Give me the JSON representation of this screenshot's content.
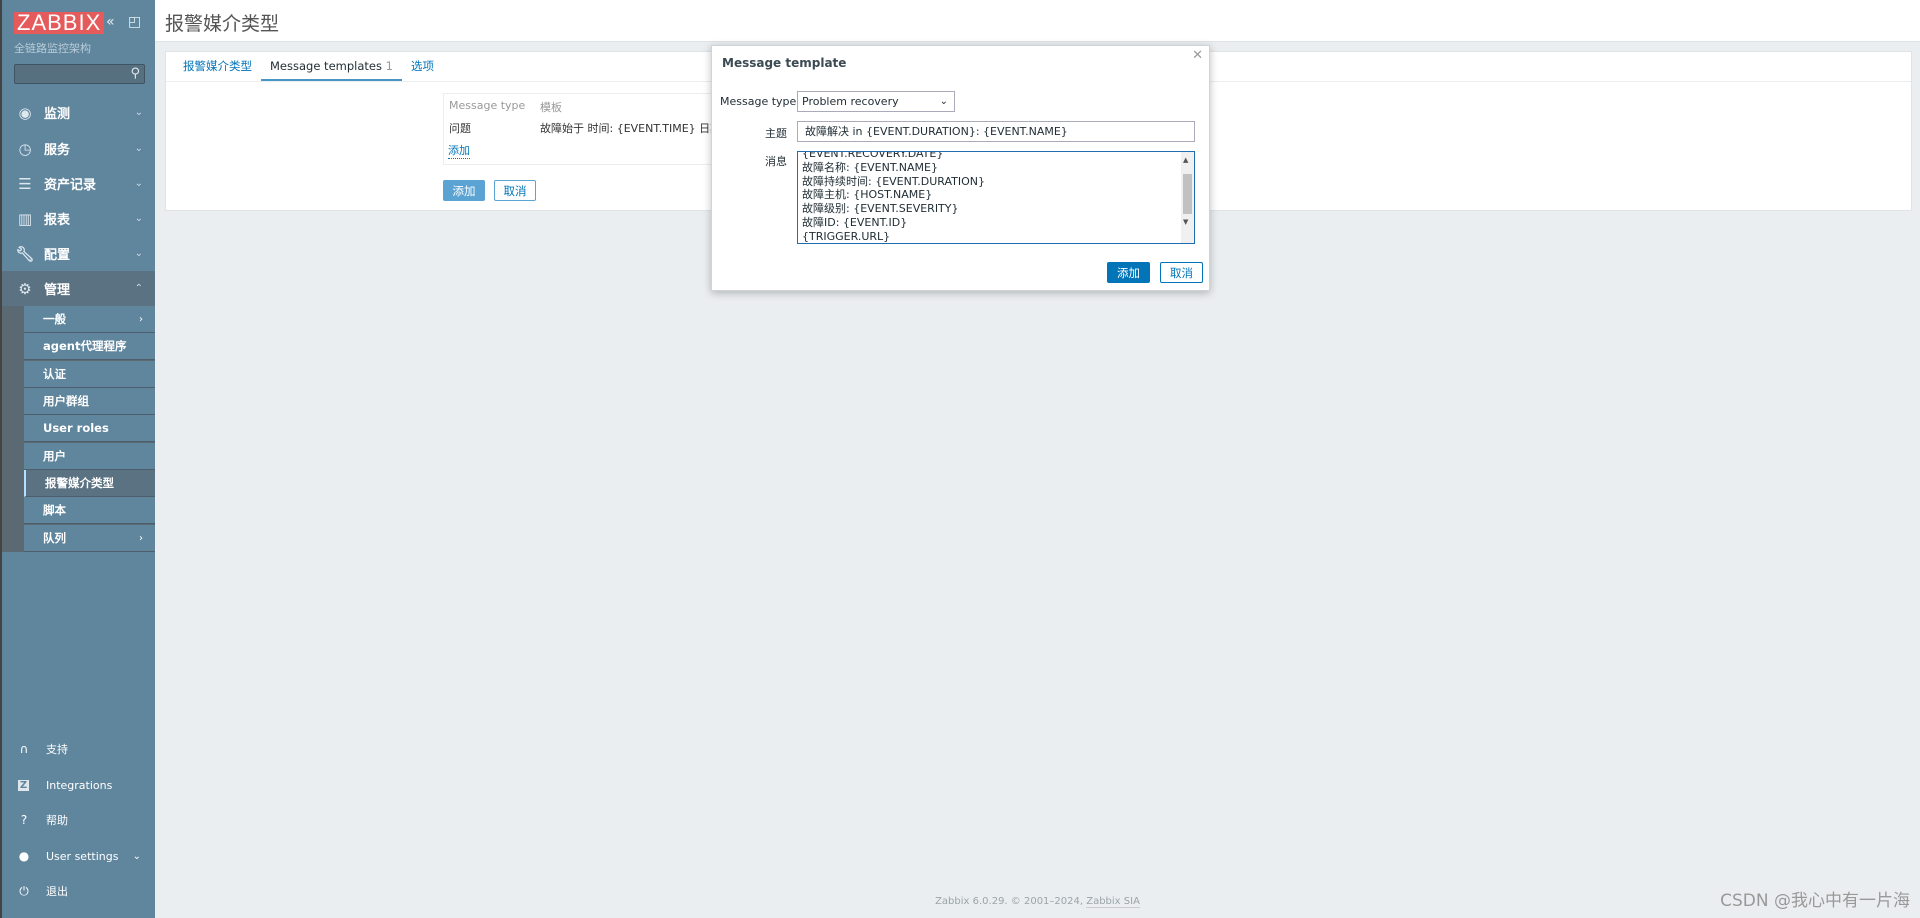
{
  "sidebar": {
    "logo": "ZABBIX",
    "subtitle": "全链路监控架构",
    "search_placeholder": "",
    "menu": [
      {
        "label": "监测",
        "icon": "eye-icon"
      },
      {
        "label": "服务",
        "icon": "stopwatch-icon"
      },
      {
        "label": "资产记录",
        "icon": "list-icon"
      },
      {
        "label": "报表",
        "icon": "bar-chart-icon"
      },
      {
        "label": "配置",
        "icon": "wrench-icon"
      },
      {
        "label": "管理",
        "icon": "gear-icon"
      }
    ],
    "admin_submenu": [
      "一般",
      "agent代理程序",
      "认证",
      "用户群组",
      "User roles",
      "用户",
      "报警媒介类型",
      "脚本",
      "队列"
    ],
    "bottom": [
      {
        "label": "支持",
        "icon": "headset-icon"
      },
      {
        "label": "Integrations",
        "icon": "zabbix-z-icon"
      },
      {
        "label": "帮助",
        "icon": "question-icon"
      },
      {
        "label": "User settings",
        "icon": "user-icon"
      },
      {
        "label": "退出",
        "icon": "power-icon"
      }
    ]
  },
  "header": {
    "title": "报警媒介类型"
  },
  "tabs": [
    {
      "label": "报警媒介类型"
    },
    {
      "label": "Message templates",
      "count": "1"
    },
    {
      "label": "选项"
    }
  ],
  "templates": {
    "col_type": "Message type",
    "col_template": "模板",
    "rows": [
      {
        "type": "问题",
        "template": "故障始于 时间: {EVENT.TIME} 日期: {"
      }
    ],
    "add_link": "添加",
    "add_button": "添加",
    "cancel_button": "取消"
  },
  "dialog": {
    "title": "Message template",
    "message_type_label": "Message type",
    "message_type_value": "Problem recovery",
    "subject_label": "主题",
    "subject_value": "故障解决 in {EVENT.DURATION}: {EVENT.NAME}",
    "message_label": "消息",
    "message_lines": [
      "{EVENT.RECOVERY.DATE}",
      "故障名称: {EVENT.NAME}",
      "故障持续时间: {EVENT.DURATION}",
      "故障主机: {HOST.NAME}",
      "故障级别: {EVENT.SEVERITY}",
      "故障ID: {EVENT.ID}",
      "{TRIGGER.URL}"
    ],
    "add_button": "添加",
    "cancel_button": "取消"
  },
  "footer": {
    "text": "Zabbix 6.0.29. © 2001–2024, ",
    "link": "Zabbix SIA"
  },
  "watermark": "CSDN @我心中有一片海",
  "colors": {
    "sidebar": "#60869e",
    "accent": "#0275b8",
    "logo": "#e55a5a"
  }
}
